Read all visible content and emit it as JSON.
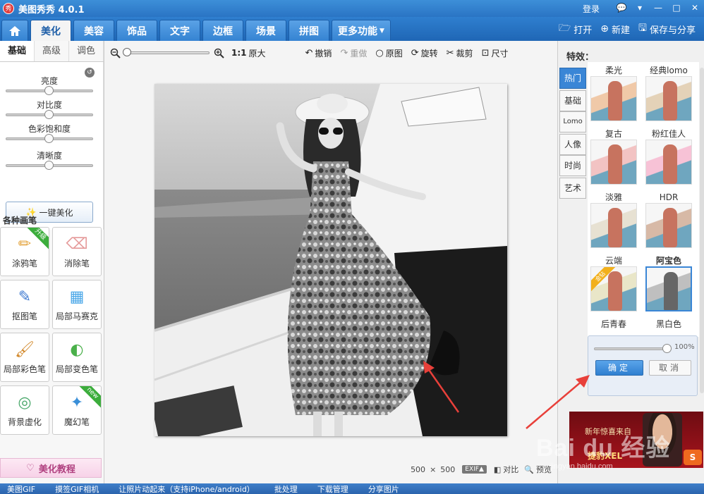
{
  "window": {
    "logo_text": "秀",
    "title": "美图秀秀 4.0.1",
    "login": "登录",
    "controls": [
      "💬",
      "▾",
      "—",
      "□",
      "✕"
    ]
  },
  "main_tabs": {
    "items": [
      "美化",
      "美容",
      "饰品",
      "文字",
      "边框",
      "场景",
      "拼图",
      "更多功能"
    ],
    "active": "美化"
  },
  "top_right": {
    "open": "打开",
    "new": "新建",
    "save_share": "保存与分享"
  },
  "left_panel": {
    "subtabs": [
      "基础",
      "高级",
      "调色"
    ],
    "active_subtab": "基础",
    "sliders": [
      {
        "label": "亮度",
        "value": 0.5
      },
      {
        "label": "对比度",
        "value": 0.5
      },
      {
        "label": "色彩饱和度",
        "value": 0.5
      },
      {
        "label": "清晰度",
        "value": 0.5
      }
    ],
    "one_key_label": "一键美化",
    "brush_section_title": "各种画笔",
    "brushes": [
      {
        "label": "涂鸦笔",
        "badge": "升级",
        "icon": "✏",
        "color": "#e3a23a"
      },
      {
        "label": "消除笔",
        "badge": "",
        "icon": "⌫",
        "color": "#e59a9a"
      },
      {
        "label": "抠图笔",
        "badge": "",
        "icon": "✎",
        "color": "#3f7ad0"
      },
      {
        "label": "局部马赛克",
        "badge": "",
        "icon": "▦",
        "color": "#4aa7e8"
      },
      {
        "label": "局部彩色笔",
        "badge": "",
        "icon": "🖌",
        "color": "#d2892c"
      },
      {
        "label": "局部变色笔",
        "badge": "",
        "icon": "◐",
        "color": "#4ab04a"
      },
      {
        "label": "背景虚化",
        "badge": "",
        "icon": "◎",
        "color": "#4aa86b"
      },
      {
        "label": "魔幻笔",
        "badge": "new",
        "icon": "✦",
        "color": "#3a8fd8"
      }
    ],
    "tutorial_label": "美化教程"
  },
  "toolbar": {
    "zoom_ratio_label": "1:1",
    "original_size": "原大",
    "undo": "撤销",
    "redo": "重做",
    "original": "原图",
    "rotate": "旋转",
    "crop": "裁剪",
    "size": "尺寸",
    "zoom_level": 0.0
  },
  "canvas": {
    "image_width": "500",
    "times": "×",
    "image_height": "500",
    "exif": "EXIF▲",
    "compare": "对比",
    "preview": "预览"
  },
  "right_panel": {
    "title": "特效：",
    "categories": [
      "热门",
      "基础",
      "Lomo",
      "人像",
      "时尚",
      "艺术"
    ],
    "active_category": "热门",
    "effects": [
      {
        "name": "柔光",
        "tint": "#f0c9a8",
        "badge": ""
      },
      {
        "name": "经典lomo",
        "tint": "#e4d2b8",
        "badge": ""
      },
      {
        "name": "复古",
        "tint": "#f2c3c3",
        "badge": ""
      },
      {
        "name": "粉红佳人",
        "tint": "#f7c2d6",
        "badge": ""
      },
      {
        "name": "淡雅",
        "tint": "#e7e1d2",
        "badge": ""
      },
      {
        "name": "HDR",
        "tint": "#d7b9a6",
        "badge": ""
      },
      {
        "name": "云端",
        "tint": "#e9e6c8",
        "badge": "金钻"
      },
      {
        "name": "阿宝色",
        "tint": "#bfbfbf",
        "badge": ""
      },
      {
        "name": "后青春",
        "tint": "",
        "badge": ""
      },
      {
        "name": "黑白色",
        "tint": "",
        "badge": ""
      }
    ],
    "selected_effect": "阿宝色",
    "intensity_value": "100%",
    "intensity": 1.0,
    "ok_label": "确定",
    "cancel_label": "取消"
  },
  "ad": {
    "line1": "新年惊喜来自",
    "line2": "捷豹XEL",
    "logo": "S"
  },
  "taskbar": {
    "items": [
      "美图GIF",
      "摸签GIF相机",
      "让照片动起来（支持iPhone/android）",
      "批处理",
      "下载管理",
      "分享图片"
    ]
  },
  "watermark": {
    "text": "Bai du 经验",
    "sub": "jingyan.baidu.com"
  },
  "colors": {
    "accent": "#2f7fcf",
    "annotation_arrow": "#e8403a"
  }
}
